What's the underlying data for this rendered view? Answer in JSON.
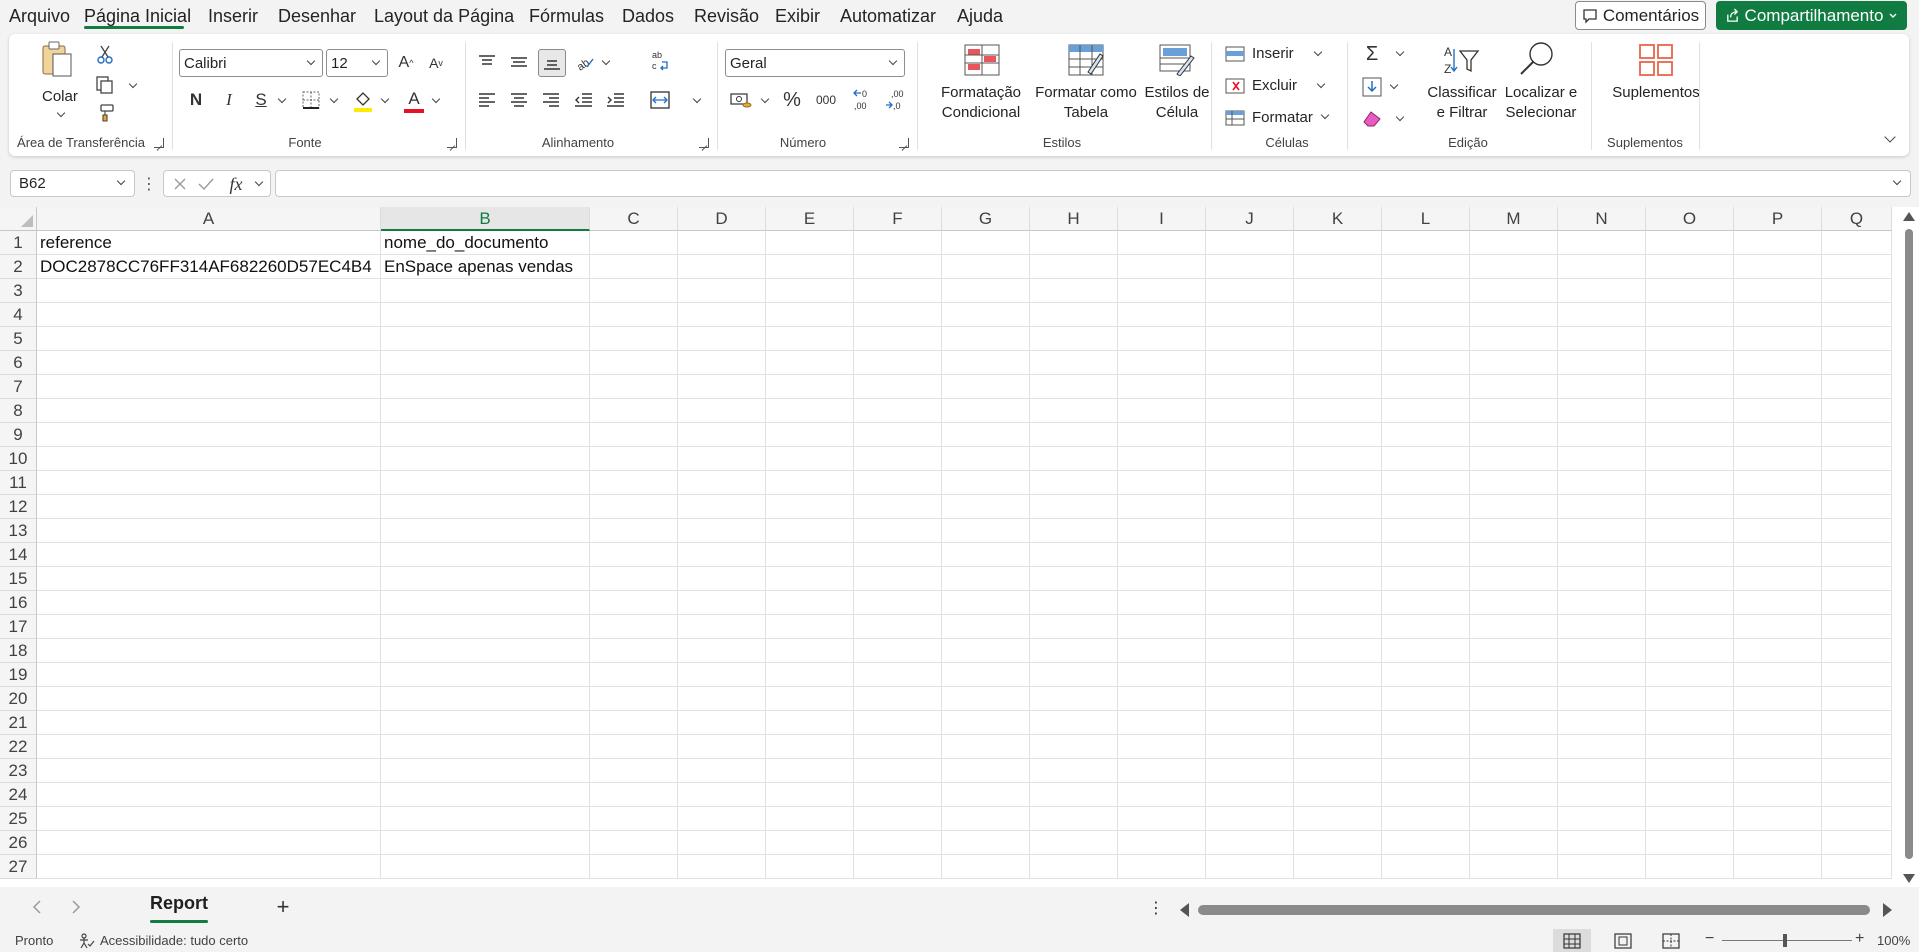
{
  "menu": {
    "tabs": [
      "Arquivo",
      "Página Inicial",
      "Inserir",
      "Desenhar",
      "Layout da Página",
      "Fórmulas",
      "Dados",
      "Revisão",
      "Exibir",
      "Automatizar",
      "Ajuda"
    ],
    "comments_label": "Comentários",
    "share_label": "Compartilhamento"
  },
  "ribbon": {
    "clipboard": {
      "paste_label": "Colar",
      "group_label": "Área de Transferência"
    },
    "font": {
      "font_name": "Calibri",
      "font_size": "12",
      "bold": "N",
      "italic": "I",
      "underline": "S",
      "group_label": "Fonte",
      "fill_color": "#ffeb00",
      "font_color": "#e81123"
    },
    "alignment": {
      "group_label": "Alinhamento"
    },
    "number": {
      "format": "Geral",
      "percent": "%",
      "thousands": "000",
      "group_label": "Número"
    },
    "styles": {
      "conditional_line1": "Formatação",
      "conditional_line2": "Condicional",
      "table_line1": "Formatar como",
      "table_line2": "Tabela",
      "cellstyles_line1": "Estilos de",
      "cellstyles_line2": "Célula",
      "group_label": "Estilos"
    },
    "cells": {
      "insert_label": "Inserir",
      "delete_label": "Excluir",
      "format_label": "Formatar",
      "group_label": "Células"
    },
    "editing": {
      "sort_line1": "Classificar",
      "sort_line2": "e Filtrar",
      "find_line1": "Localizar e",
      "find_line2": "Selecionar",
      "group_label": "Edição"
    },
    "addins": {
      "label": "Suplementos",
      "group_label": "Suplementos"
    }
  },
  "formula_bar": {
    "name_box": "B62",
    "formula": "",
    "fx": "fx"
  },
  "grid": {
    "columns": [
      "A",
      "B",
      "C",
      "D",
      "E",
      "F",
      "G",
      "H",
      "I",
      "J",
      "K",
      "L",
      "M",
      "N",
      "O",
      "P",
      "Q"
    ],
    "selected_column": "B",
    "rows": [
      "1",
      "2",
      "3",
      "4",
      "5",
      "6",
      "7",
      "8",
      "9",
      "10",
      "11",
      "12",
      "13",
      "14",
      "15",
      "16",
      "17",
      "18",
      "19",
      "20",
      "21",
      "22",
      "23",
      "24",
      "25",
      "26",
      "27"
    ],
    "cells": {
      "A1": "reference",
      "B1": "nome_do_documento",
      "A2": "DOC2878CC76FF314AF682260D57EC4B4",
      "B2": "EnSpace apenas vendas"
    }
  },
  "sheets": {
    "tabs": [
      "Report"
    ],
    "active": "Report"
  },
  "status": {
    "ready": "Pronto",
    "accessibility": "Acessibilidade: tudo certo",
    "zoom": "100%"
  },
  "colors": {
    "accent": "#107c41"
  }
}
